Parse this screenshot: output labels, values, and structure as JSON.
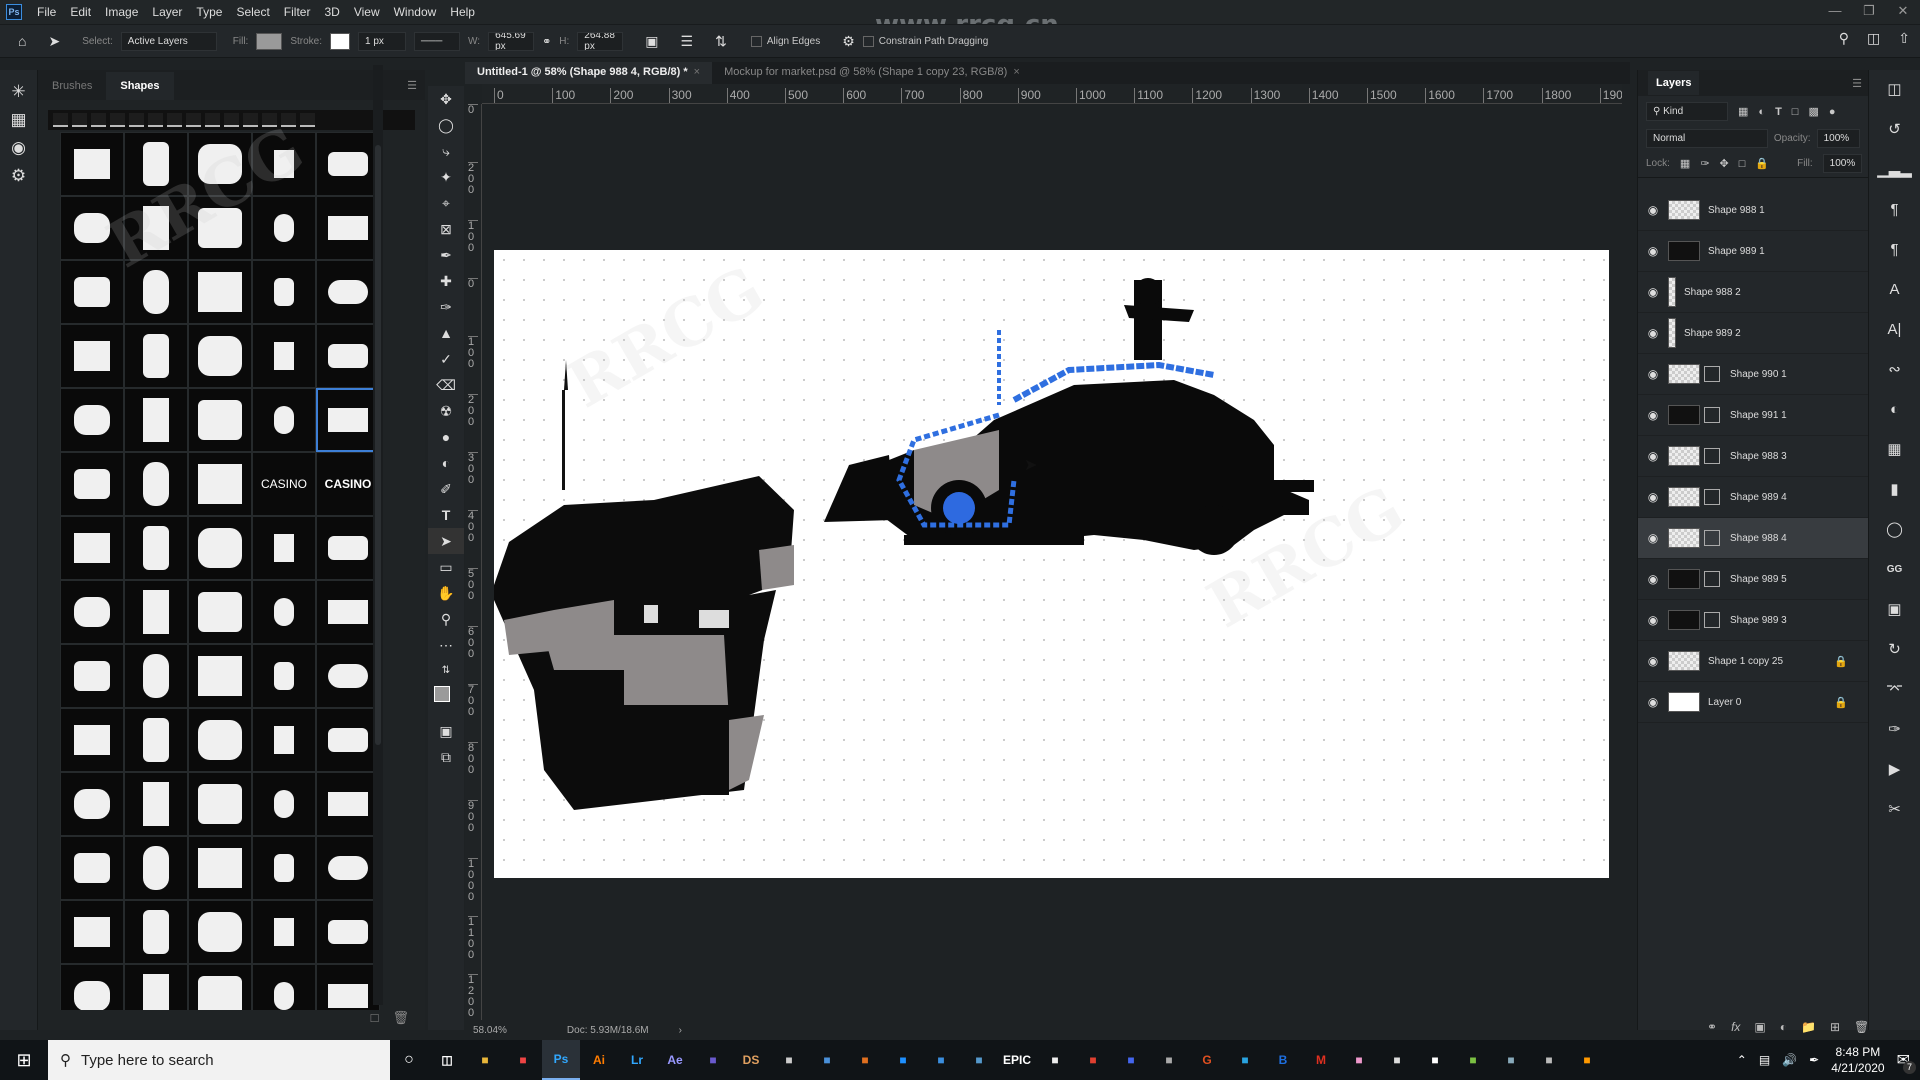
{
  "app": {
    "name": "Ps"
  },
  "menu": [
    "File",
    "Edit",
    "Image",
    "Layer",
    "Type",
    "Select",
    "Filter",
    "3D",
    "View",
    "Window",
    "Help"
  ],
  "window_controls": {
    "minimize": "minimize-icon",
    "restore": "restore-icon",
    "close": "close-icon"
  },
  "watermark_url": "www.rrcg.cn",
  "options": {
    "select_label": "Select:",
    "select_value": "Active Layers",
    "fill_label": "Fill:",
    "stroke_label": "Stroke:",
    "stroke_width": "1 px",
    "w_label": "W:",
    "w_value": "645.69 px",
    "h_label": "H:",
    "h_value": "264.88 px",
    "align_edges": "Align Edges",
    "constrain": "Constrain Path Dragging",
    "fill_color": "#9a9a9a"
  },
  "shapes_panel": {
    "tabs": [
      {
        "label": "Brushes",
        "active": false
      },
      {
        "label": "Shapes",
        "active": true
      }
    ],
    "grid_labels": {
      "casino_1": "CASINO",
      "casino_2": "CASINO"
    }
  },
  "documents": [
    {
      "label": "Untitled-1 @ 58% (Shape 988 4, RGB/8) *",
      "active": true
    },
    {
      "label": "Mockup for market.psd @ 58% (Shape 1 copy 23, RGB/8)",
      "active": false
    }
  ],
  "rulers": {
    "horizontal": [
      "0",
      "100",
      "200",
      "300",
      "400",
      "500",
      "600",
      "700",
      "800",
      "900",
      "1000",
      "1100",
      "1200",
      "1300",
      "1400",
      "1500",
      "1600",
      "1700",
      "1800",
      "190"
    ],
    "vertical": [
      "0",
      "200",
      "100",
      "0",
      "100",
      "200",
      "300",
      "400",
      "500",
      "600",
      "700",
      "800",
      "900",
      "1000",
      "1100",
      "1200",
      "1"
    ]
  },
  "status": {
    "zoom": "58.04%",
    "doc": "Doc: 5.93M/18.6M"
  },
  "layers_panel": {
    "title": "Layers",
    "filter_kind": "Kind",
    "blend_mode": "Normal",
    "opacity_label": "Opacity:",
    "opacity": "100%",
    "lock_label": "Lock:",
    "fill_label": "Fill:",
    "fill": "100%",
    "layers": [
      {
        "name": "Shape 988 1",
        "thumb": "checker",
        "mask": false,
        "locked": false,
        "selected": false
      },
      {
        "name": "Shape 989 1",
        "thumb": "dark",
        "mask": false,
        "locked": false,
        "selected": false
      },
      {
        "name": "Shape 988 2",
        "thumb": "thin",
        "mask": false,
        "locked": false,
        "selected": false
      },
      {
        "name": "Shape 989 2",
        "thumb": "thin",
        "mask": false,
        "locked": false,
        "selected": false
      },
      {
        "name": "Shape 990 1",
        "thumb": "checker",
        "mask": true,
        "locked": false,
        "selected": false
      },
      {
        "name": "Shape 991 1",
        "thumb": "dark",
        "mask": true,
        "locked": false,
        "selected": false
      },
      {
        "name": "Shape 988 3",
        "thumb": "checker",
        "mask": true,
        "locked": false,
        "selected": false
      },
      {
        "name": "Shape 989 4",
        "thumb": "checker",
        "mask": true,
        "locked": false,
        "selected": false
      },
      {
        "name": "Shape 988 4",
        "thumb": "checker",
        "mask": true,
        "locked": false,
        "selected": true
      },
      {
        "name": "Shape 989 5",
        "thumb": "dark",
        "mask": true,
        "locked": false,
        "selected": false
      },
      {
        "name": "Shape 989 3",
        "thumb": "dark",
        "mask": true,
        "locked": false,
        "selected": false
      },
      {
        "name": "Shape 1 copy 25",
        "thumb": "checker",
        "mask": false,
        "locked": true,
        "selected": false
      },
      {
        "name": "Layer 0",
        "thumb": "white",
        "mask": false,
        "locked": true,
        "selected": false
      }
    ]
  },
  "taskbar": {
    "search_placeholder": "Type here to search",
    "apps": [
      "File Explorer",
      "Chrome",
      "Ps",
      "Ai",
      "Lr",
      "Ae",
      "Substance",
      "DS",
      "Tool",
      "Blender",
      "Marmoset",
      "Skype",
      "Edge",
      "Steam",
      "EPIC",
      "Unreal",
      "Substance Painter",
      "Marvelous",
      "Tool",
      "G",
      "Tool",
      "B",
      "M",
      "Slack",
      "Display",
      "ZBrush",
      "uTorrent",
      "App",
      "App",
      "Search"
    ],
    "active_app": "Ps",
    "time": "8:48 PM",
    "date": "4/21/2020",
    "notifications": "7"
  },
  "colors": {
    "accent": "#3d7fd6",
    "selection": "#2f6fe0",
    "canvas": "#ffffff",
    "panel": "#23272a"
  }
}
